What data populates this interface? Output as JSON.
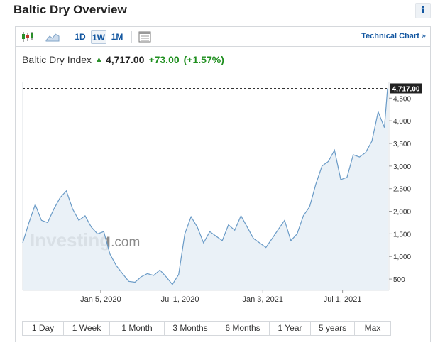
{
  "header": {
    "title": "Baltic Dry Overview",
    "info_label": "i"
  },
  "toolbar": {
    "intervals": [
      "1D",
      "1W",
      "1M"
    ],
    "active_interval": "1W",
    "technical_link": "Technical Chart",
    "technical_chevron": "»",
    "icons": [
      "candlestick-icon",
      "area-chart-icon",
      "table-view-icon"
    ]
  },
  "quote": {
    "name": "Baltic Dry Index",
    "direction_icon": "up-arrow-icon",
    "price": "4,717.00",
    "change": "+73.00",
    "change_pct": "(+1.57%)",
    "up_color": "#1f8f1f"
  },
  "watermark": {
    "brand": "Investing",
    "suffix": ".com"
  },
  "chart_data": {
    "type": "area",
    "title": "",
    "xlabel": "",
    "ylabel": "",
    "x_ticks": [
      "Jan 5, 2020",
      "Jul 1, 2020",
      "Jan 3, 2021",
      "Jul 1, 2021"
    ],
    "x_tick_dates": [
      "2020-01-05",
      "2020-07-01",
      "2021-01-03",
      "2021-07-01"
    ],
    "xlim": [
      "2019-07-14",
      "2021-10-10"
    ],
    "y_ticks": [
      "500",
      "1,000",
      "1,500",
      "2,000",
      "2,500",
      "3,000",
      "3,500",
      "4,000",
      "4,500"
    ],
    "y_tick_values": [
      500,
      1000,
      1500,
      2000,
      2500,
      3000,
      3500,
      4000,
      4500
    ],
    "ylim": [
      250,
      4850
    ],
    "last_value_label": "4,717.00",
    "last_value": 4717,
    "line_color": "#6a9bc7",
    "fill_color": "#e6eef6",
    "grid": false,
    "series": [
      {
        "x": [
          "2019-07-14",
          "2019-07-28",
          "2019-08-11",
          "2019-08-25",
          "2019-09-08",
          "2019-09-22",
          "2019-10-06",
          "2019-10-20",
          "2019-11-03",
          "2019-11-17",
          "2019-12-01",
          "2019-12-15",
          "2019-12-29",
          "2020-01-12",
          "2020-01-26",
          "2020-02-09",
          "2020-02-23",
          "2020-03-08",
          "2020-03-22",
          "2020-04-05",
          "2020-04-19",
          "2020-05-03",
          "2020-05-17",
          "2020-05-31",
          "2020-06-14",
          "2020-06-28",
          "2020-07-12",
          "2020-07-26",
          "2020-08-09",
          "2020-08-23",
          "2020-09-06",
          "2020-09-20",
          "2020-10-04",
          "2020-10-18",
          "2020-11-01",
          "2020-11-15",
          "2020-11-29",
          "2020-12-13",
          "2020-12-27",
          "2021-01-10",
          "2021-01-24",
          "2021-02-07",
          "2021-02-21",
          "2021-03-07",
          "2021-03-21",
          "2021-04-04",
          "2021-04-18",
          "2021-05-02",
          "2021-05-16",
          "2021-05-30",
          "2021-06-13",
          "2021-06-27",
          "2021-07-11",
          "2021-07-25",
          "2021-08-08",
          "2021-08-22",
          "2021-09-05",
          "2021-09-19",
          "2021-10-03",
          "2021-10-10"
        ],
        "values": [
          1300,
          1750,
          2150,
          1800,
          1750,
          2050,
          2300,
          2450,
          2050,
          1800,
          1900,
          1650,
          1500,
          1550,
          1050,
          800,
          620,
          450,
          430,
          550,
          620,
          580,
          700,
          550,
          380,
          600,
          1500,
          1880,
          1650,
          1300,
          1550,
          1450,
          1350,
          1700,
          1580,
          1900,
          1650,
          1400,
          1300,
          1200,
          1400,
          1600,
          1800,
          1350,
          1500,
          1900,
          2100,
          2600,
          3000,
          3100,
          3350,
          2700,
          2750,
          3250,
          3200,
          3300,
          3550,
          4200,
          3850,
          4717
        ]
      }
    ]
  },
  "ranges": [
    "1 Day",
    "1 Week",
    "1 Month",
    "3 Months",
    "6 Months",
    "1 Year",
    "5 years",
    "Max"
  ]
}
